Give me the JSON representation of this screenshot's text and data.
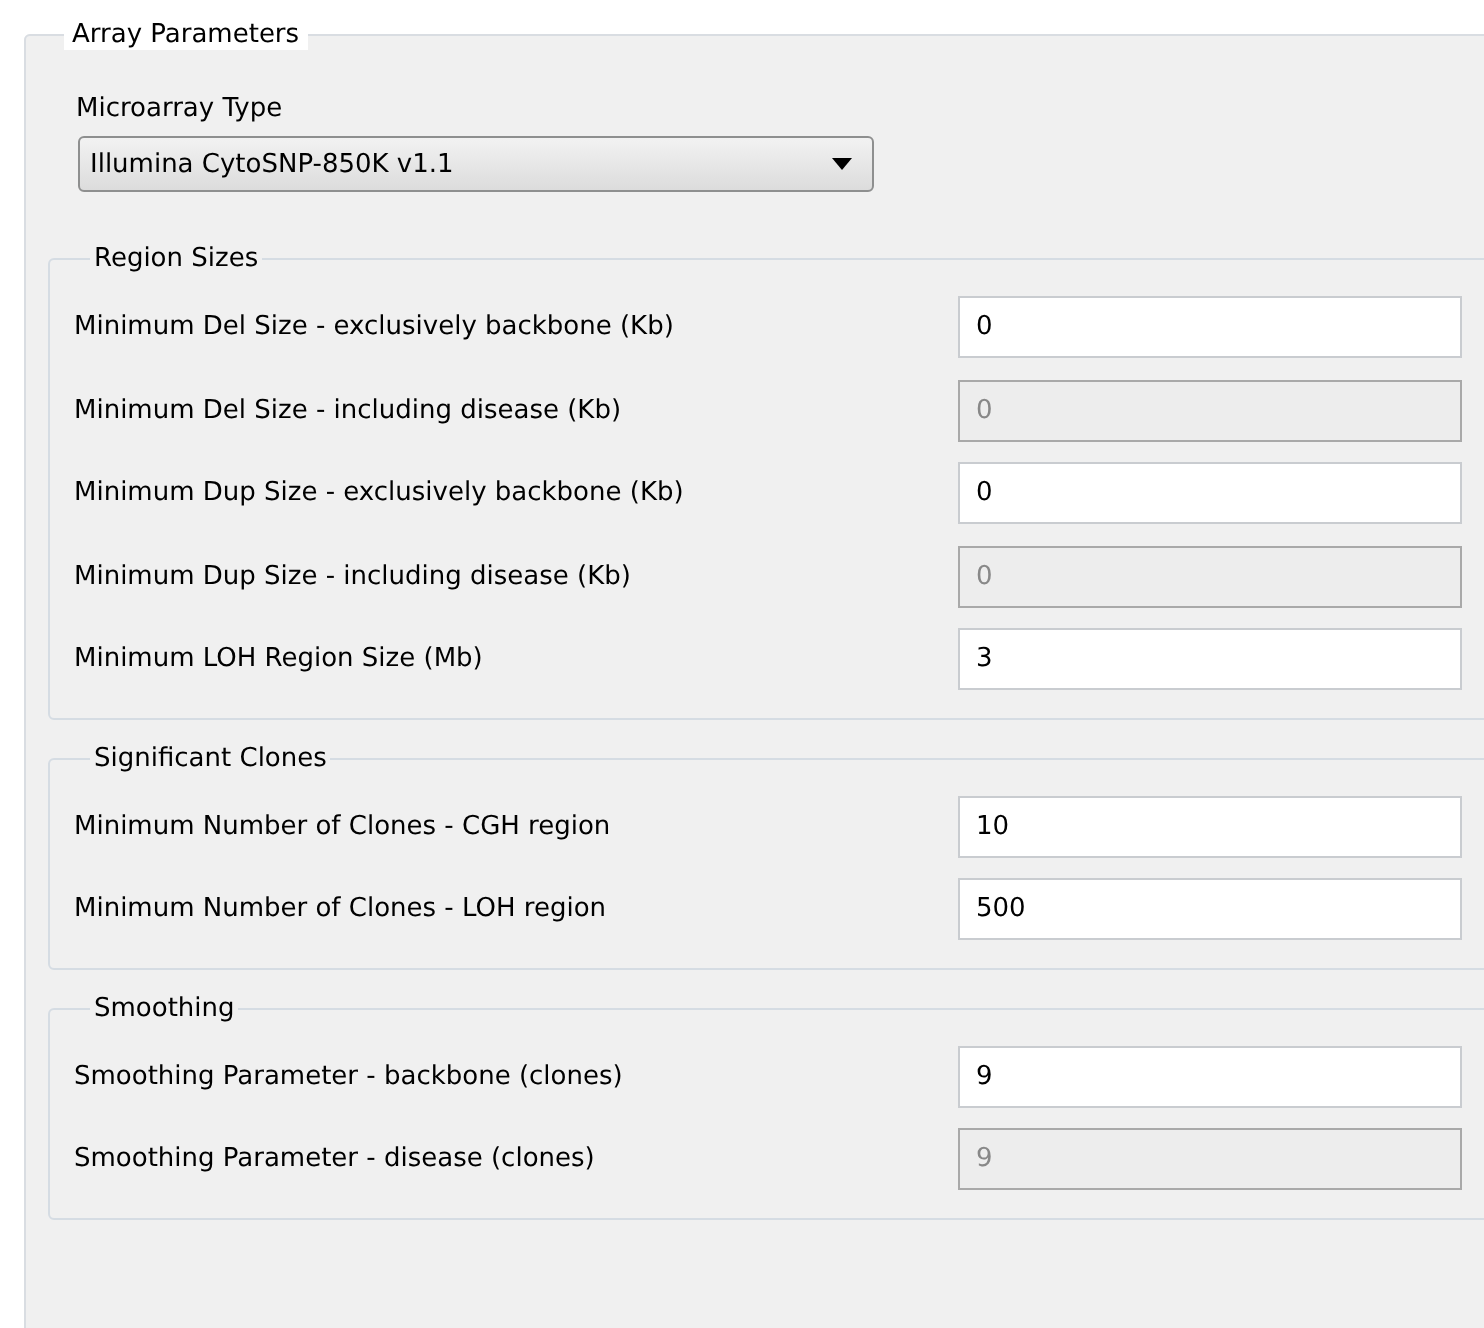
{
  "group": {
    "title": "Array Parameters"
  },
  "microarray_type": {
    "label": "Microarray Type",
    "value": "Illumina CytoSNP-850K v1.1"
  },
  "sections": [
    {
      "title": "Region Sizes",
      "fields": [
        {
          "label": "Minimum Del Size - exclusively backbone  (Kb)",
          "value": "0",
          "disabled": false
        },
        {
          "label": "Minimum Del Size - including disease  (Kb)",
          "value": "0",
          "disabled": true
        },
        {
          "label": "Minimum Dup Size - exclusively backbone  (Kb)",
          "value": "0",
          "disabled": false
        },
        {
          "label": "Minimum Dup Size - including disease  (Kb)",
          "value": "0",
          "disabled": true
        },
        {
          "label": "Minimum LOH Region Size  (Mb)",
          "value": "3",
          "disabled": false
        }
      ]
    },
    {
      "title": "Significant Clones",
      "fields": [
        {
          "label": "Minimum Number of Clones - CGH region",
          "value": "10",
          "disabled": false
        },
        {
          "label": "Minimum Number of Clones - LOH region",
          "value": "500",
          "disabled": false
        }
      ]
    },
    {
      "title": "Smoothing",
      "fields": [
        {
          "label": "Smoothing Parameter - backbone (clones)",
          "value": "9",
          "disabled": false
        },
        {
          "label": "Smoothing Parameter - disease (clones)",
          "value": "9",
          "disabled": true
        }
      ]
    }
  ]
}
